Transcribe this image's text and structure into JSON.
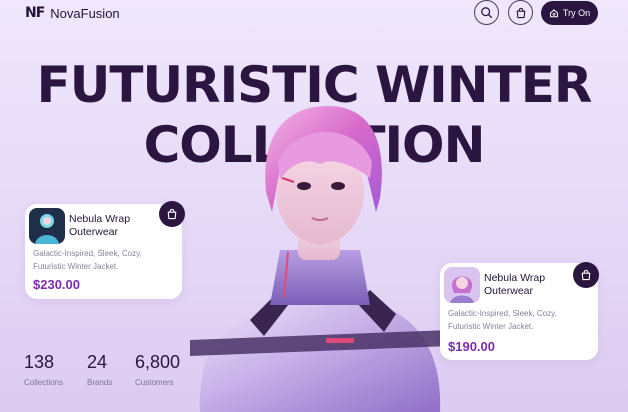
{
  "brand": {
    "mark": "NF",
    "name": "NovaFusion"
  },
  "header": {
    "search_icon": "search-icon",
    "bag_icon": "shopping-bag-icon",
    "try_on_label": "Try On"
  },
  "hero": {
    "line1": "FUTURISTIC WINTER",
    "line2": "COLLECTION"
  },
  "products": [
    {
      "name_line1": "Nebula Wrap",
      "name_line2": "Outerwear",
      "description_line1": "Galactic-Inspired, Sleek, Cozy,",
      "description_line2": "Futuristic Winter Jacket.",
      "price": "$230.00"
    },
    {
      "name_line1": "Nebula Wrap",
      "name_line2": "Outerwear",
      "description_line1": "Galactic-Inspired, Sleek, Cozy,",
      "description_line2": "Futuristic Winter Jacket.",
      "price": "$190.00"
    }
  ],
  "stats": [
    {
      "value": "138",
      "label": "Collections"
    },
    {
      "value": "24",
      "label": "Brands"
    },
    {
      "value": "6,800",
      "label": "Customers"
    }
  ],
  "colors": {
    "accent_dark": "#2b1541",
    "price_purple": "#7b2bb4",
    "background": "#efe7fb"
  }
}
